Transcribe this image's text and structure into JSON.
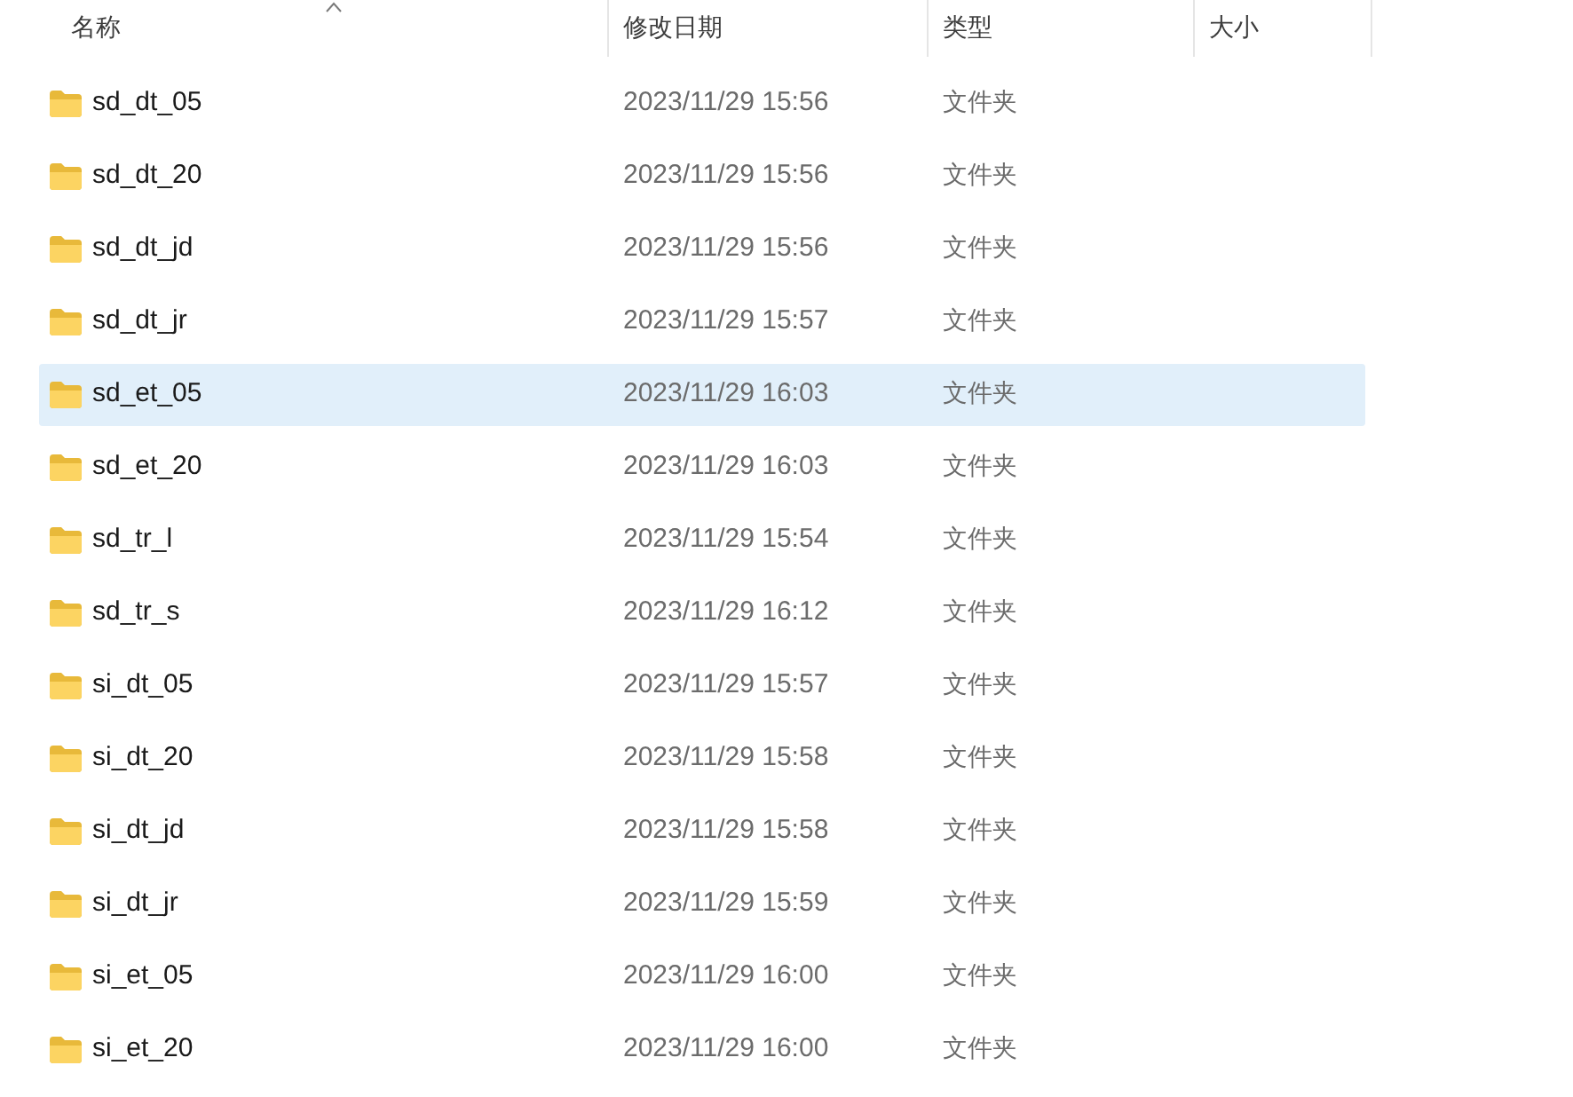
{
  "columns": [
    {
      "label": "名称",
      "sorted": true
    },
    {
      "label": "修改日期",
      "sorted": false
    },
    {
      "label": "类型",
      "sorted": false
    },
    {
      "label": "大小",
      "sorted": false
    }
  ],
  "rows": [
    {
      "name": "sd_dt_05",
      "modified": "2023/11/29 15:56",
      "type": "文件夹",
      "selected": false
    },
    {
      "name": "sd_dt_20",
      "modified": "2023/11/29 15:56",
      "type": "文件夹",
      "selected": false
    },
    {
      "name": "sd_dt_jd",
      "modified": "2023/11/29 15:56",
      "type": "文件夹",
      "selected": false
    },
    {
      "name": "sd_dt_jr",
      "modified": "2023/11/29 15:57",
      "type": "文件夹",
      "selected": false
    },
    {
      "name": "sd_et_05",
      "modified": "2023/11/29 16:03",
      "type": "文件夹",
      "selected": true
    },
    {
      "name": "sd_et_20",
      "modified": "2023/11/29 16:03",
      "type": "文件夹",
      "selected": false
    },
    {
      "name": "sd_tr_l",
      "modified": "2023/11/29 15:54",
      "type": "文件夹",
      "selected": false
    },
    {
      "name": "sd_tr_s",
      "modified": "2023/11/29 16:12",
      "type": "文件夹",
      "selected": false
    },
    {
      "name": "si_dt_05",
      "modified": "2023/11/29 15:57",
      "type": "文件夹",
      "selected": false
    },
    {
      "name": "si_dt_20",
      "modified": "2023/11/29 15:58",
      "type": "文件夹",
      "selected": false
    },
    {
      "name": "si_dt_jd",
      "modified": "2023/11/29 15:58",
      "type": "文件夹",
      "selected": false
    },
    {
      "name": "si_dt_jr",
      "modified": "2023/11/29 15:59",
      "type": "文件夹",
      "selected": false
    },
    {
      "name": "si_et_05",
      "modified": "2023/11/29 16:00",
      "type": "文件夹",
      "selected": false
    },
    {
      "name": "si_et_20",
      "modified": "2023/11/29 16:00",
      "type": "文件夹",
      "selected": false
    }
  ]
}
